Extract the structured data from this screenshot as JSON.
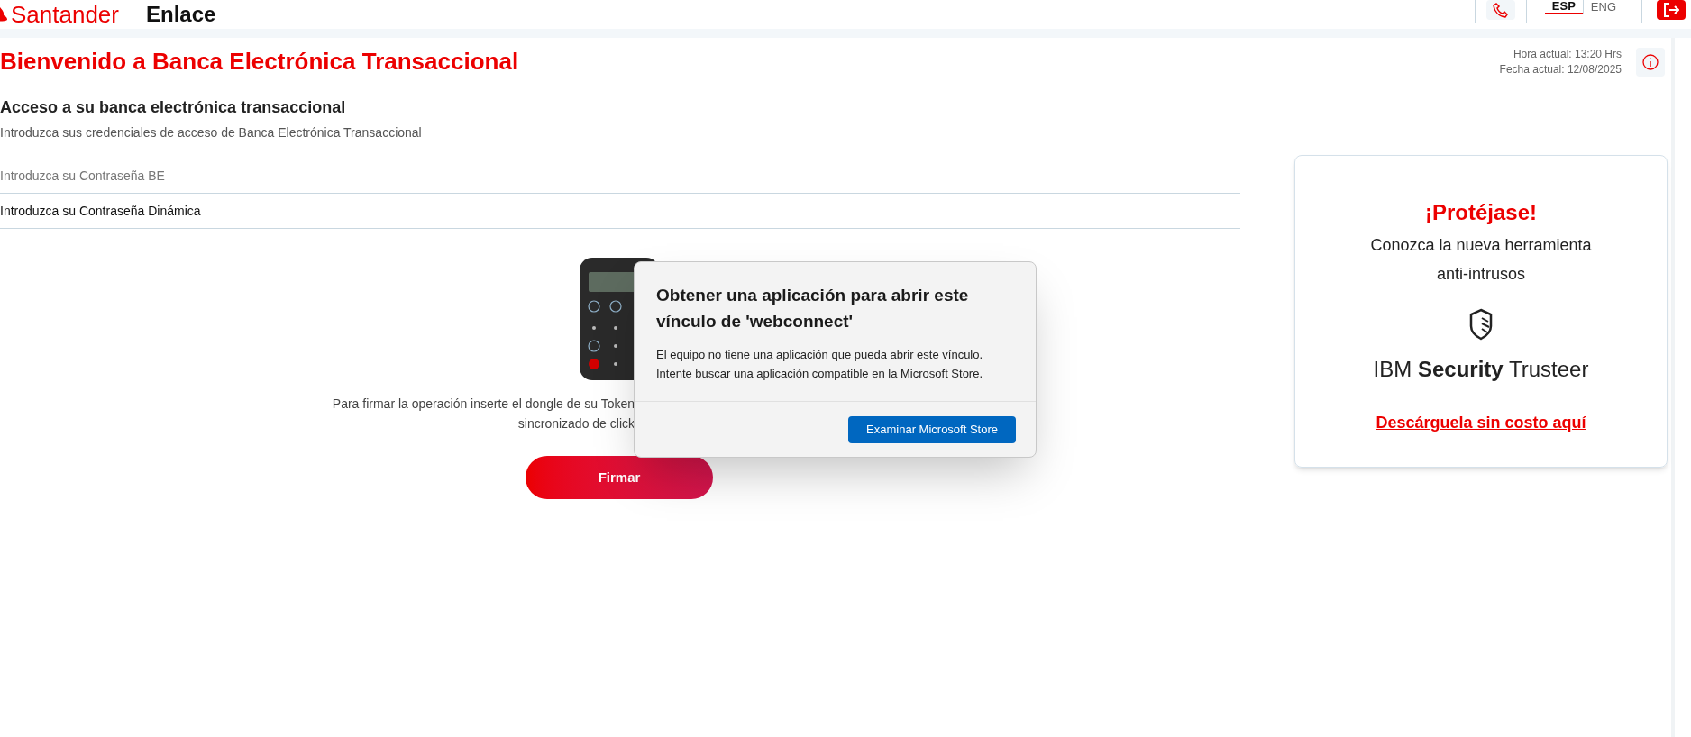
{
  "header": {
    "logo": "Santander",
    "product": "Enlace",
    "languages": [
      {
        "label": "ESP",
        "selected": true
      },
      {
        "label": "ENG",
        "selected": false
      }
    ]
  },
  "page": {
    "title": "Bienvenido a Banca Electrónica Transaccional",
    "time_label": "Hora actual:",
    "time": "13:20 Hrs",
    "date_label": "Fecha actual:",
    "date": "12/08/2025"
  },
  "access": {
    "heading": "Acceso a su banca electrónica transaccional",
    "subtitle": "Introduzca sus credenciales de acceso de Banca Electrónica Transaccional",
    "fields": [
      {
        "kind": "input",
        "placeholder": "Introduzca su Contraseña BE"
      },
      {
        "kind": "label",
        "text": "Introduzca su Contraseña Dinámica"
      }
    ]
  },
  "token": {
    "instructions": [
      "Para firmar la operación inserte el dongle de su Token",
      "sincronizado de click"
    ],
    "button": "Firmar"
  },
  "promo": {
    "title": "¡Protéjase!",
    "text": "Conozca la nueva herramienta anti-intrusos",
    "brand": "IBM **Security** Trusteer",
    "link": "Descárguela sin costo aquí"
  },
  "dialog": {
    "title": "Obtener una aplicación para abrir este vínculo de 'webconnect'",
    "message": "El equipo no tiene una aplicación que pueda abrir este vínculo. Intente buscar una aplicación compatible en la Microsoft Store.",
    "button": "Examinar Microsoft Store"
  }
}
